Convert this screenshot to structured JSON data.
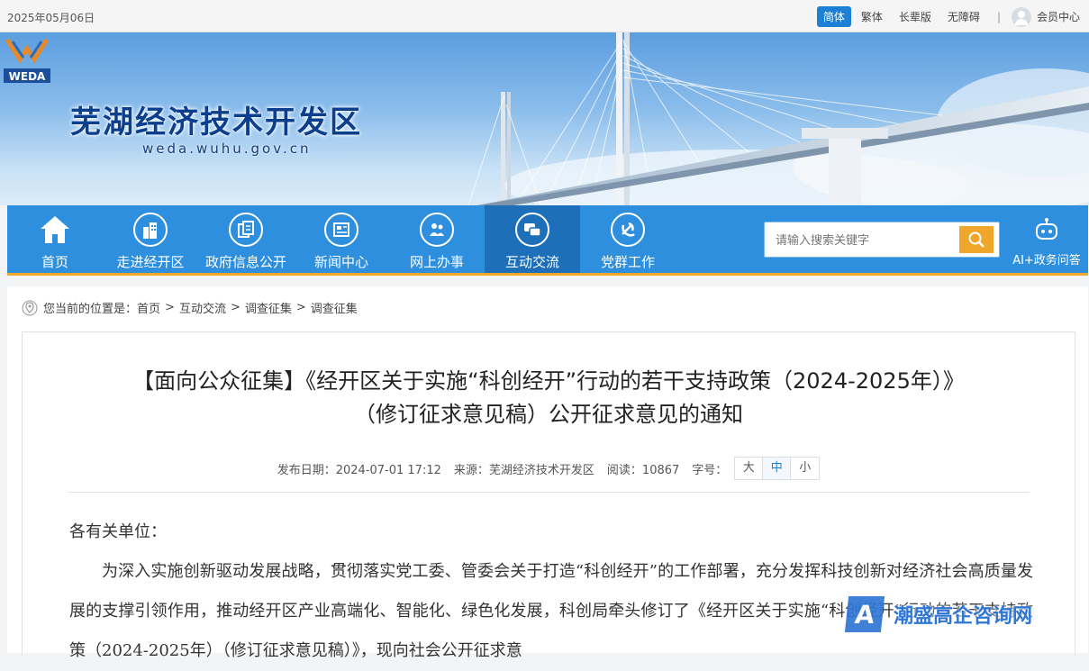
{
  "topbar": {
    "date": "2025年05月06日",
    "links": [
      {
        "label": "简体",
        "active": true
      },
      {
        "label": "繁体",
        "active": false
      },
      {
        "label": "长辈版",
        "active": false
      },
      {
        "label": "无障碍",
        "active": false
      }
    ],
    "separator": "|",
    "member_center": "会员中心"
  },
  "header": {
    "logo_text": "WEDA",
    "site_name": "芜湖经济技术开发区",
    "site_url": "weda.wuhu.gov.cn"
  },
  "nav": {
    "items": [
      {
        "label": "首页",
        "icon": "home-icon",
        "active": false
      },
      {
        "label": "走进经开区",
        "icon": "buildings-icon",
        "active": false
      },
      {
        "label": "政府信息公开",
        "icon": "documents-icon",
        "active": false
      },
      {
        "label": "新闻中心",
        "icon": "newspaper-icon",
        "active": false
      },
      {
        "label": "网上办事",
        "icon": "people-icon",
        "active": false
      },
      {
        "label": "互动交流",
        "icon": "chat-icon",
        "active": true
      },
      {
        "label": "党群工作",
        "icon": "party-emblem-icon",
        "active": false
      }
    ],
    "search_placeholder": "请输入搜索关键字",
    "ai_label": "AI+政务问答"
  },
  "breadcrumb": {
    "prefix": "您当前的位置是：",
    "items": [
      "首页",
      "互动交流",
      "调查征集",
      "调查征集"
    ],
    "separator": ">"
  },
  "article": {
    "title_line1": "【面向公众征集】《经开区关于实施“科创经开”行动的若干支持政策（2024-2025年）》",
    "title_line2": "（修订征求意见稿）公开征求意见的通知",
    "publish_date_label": "发布日期：",
    "publish_date": "2024-07-01 17:12",
    "source_label": "来源：",
    "source": "芜湖经济技术开发区",
    "views_label": "阅读：",
    "views": "10867",
    "font_size_label": "字号：",
    "font_sizes": [
      {
        "label": "大",
        "active": false
      },
      {
        "label": "中",
        "active": true
      },
      {
        "label": "小",
        "active": false
      }
    ],
    "salutation": "各有关单位：",
    "paragraph1": "为深入实施创新驱动发展战略，贯彻落实党工委、管委会关于打造“科创经开”的工作部署，充分发挥科技创新对经济社会高质量发展的支撑引领作用，推动经开区产业高端化、智能化、绿色化发展，科创局牵头修订了《经开区关于实施“科创经开”行动的若干支持政策（2024-2025年）（修订征求意见稿）》，现向社会公开征求意"
  },
  "watermark": {
    "logo_letter": "A",
    "text": "潮盛高企咨询网"
  },
  "colors": {
    "nav_blue": "#2e8fde",
    "nav_active": "#1c6fb8",
    "accent_orange": "#f0a52b",
    "brand_navy": "#0b3e8c",
    "link_blue": "#1e7fd6"
  }
}
